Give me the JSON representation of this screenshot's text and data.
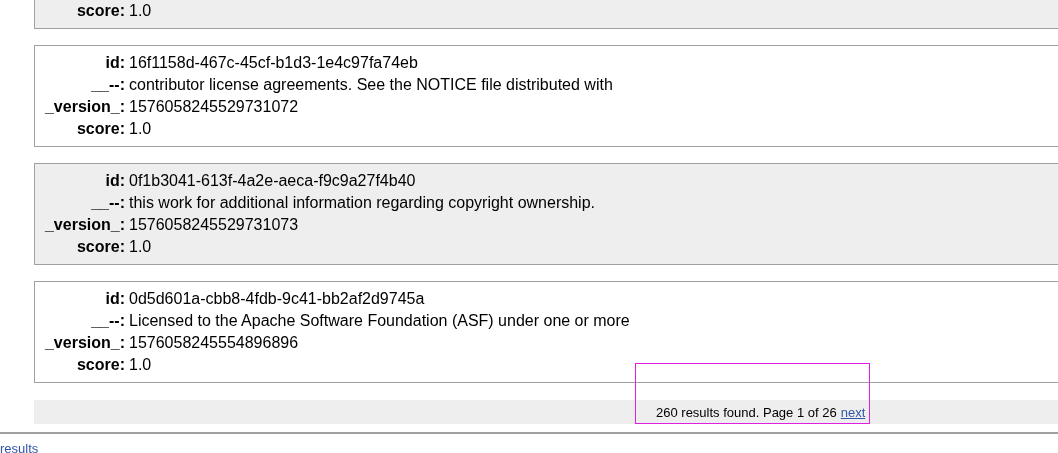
{
  "documents": [
    {
      "shaded": true,
      "fields": [
        {
          "label": "score:",
          "value": "1.0"
        }
      ]
    },
    {
      "shaded": false,
      "fields": [
        {
          "label": "id:",
          "value": "16f1158d-467c-45cf-b1d3-1e4c97fa74eb"
        },
        {
          "label": "__--:",
          "value": "contributor license agreements. See the NOTICE file distributed with"
        },
        {
          "label": "_version_:",
          "value": "1576058245529731072"
        },
        {
          "label": "score:",
          "value": "1.0"
        }
      ]
    },
    {
      "shaded": true,
      "fields": [
        {
          "label": "id:",
          "value": "0f1b3041-613f-4a2e-aeca-f9c9a27f4b40"
        },
        {
          "label": "__--:",
          "value": "this work for additional information regarding copyright ownership."
        },
        {
          "label": "_version_:",
          "value": "1576058245529731073"
        },
        {
          "label": "score:",
          "value": "1.0"
        }
      ]
    },
    {
      "shaded": false,
      "fields": [
        {
          "label": "id:",
          "value": "0d5d601a-cbb8-4fdb-9c41-bb2af2d9745a"
        },
        {
          "label": "__--:",
          "value": "Licensed to the Apache Software Foundation (ASF) under one or more"
        },
        {
          "label": "_version_:",
          "value": "1576058245554896896"
        },
        {
          "label": "score:",
          "value": "1.0"
        }
      ]
    }
  ],
  "pager": {
    "summary": "260 results found. Page 1 of 26",
    "next_link": "next",
    "highlighted": true
  },
  "footer_link": "results"
}
